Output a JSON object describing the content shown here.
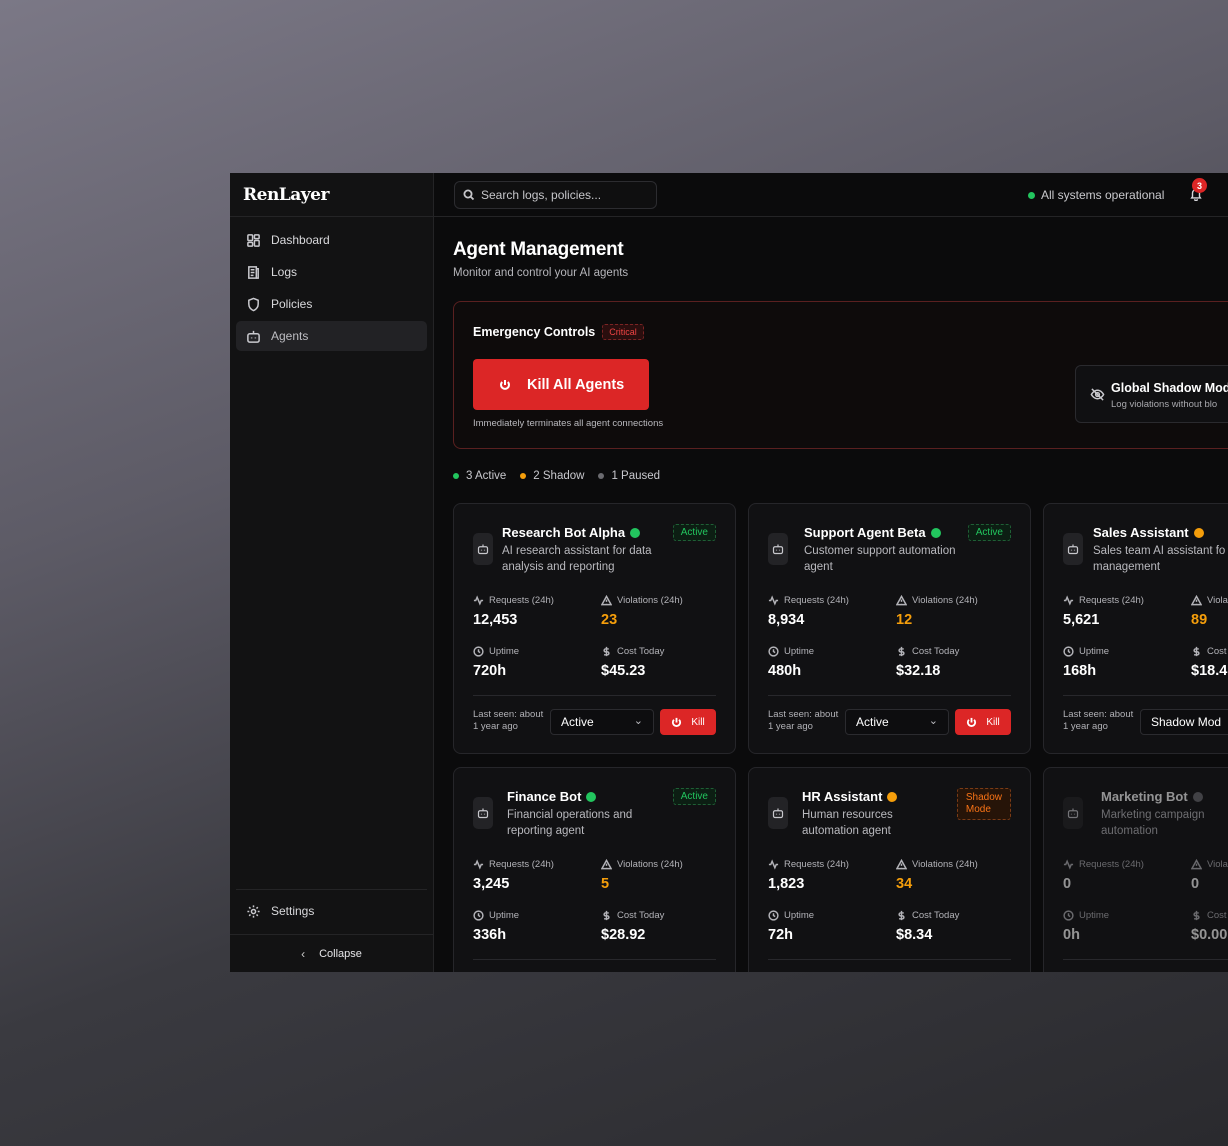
{
  "app": {
    "logo": "RenLayer"
  },
  "sidebar": {
    "items": [
      {
        "label": "Dashboard",
        "icon": "dashboard-icon"
      },
      {
        "label": "Logs",
        "icon": "logs-icon"
      },
      {
        "label": "Policies",
        "icon": "shield-icon"
      },
      {
        "label": "Agents",
        "icon": "bot-icon",
        "active": true
      }
    ],
    "settings_label": "Settings",
    "collapse_label": "Collapse"
  },
  "topbar": {
    "search_placeholder": "Search logs, policies...",
    "status_text": "All systems operational",
    "notification_count": "3"
  },
  "page": {
    "title": "Agent Management",
    "subtitle": "Monitor and control your AI agents"
  },
  "emergency": {
    "title": "Emergency Controls",
    "badge": "Critical",
    "kill_all_label": "Kill All Agents",
    "kill_all_note": "Immediately terminates all agent connections",
    "shadow_title": "Global Shadow Mod",
    "shadow_sub": "Log violations without blo"
  },
  "counts": {
    "active": "3 Active",
    "shadow": "2 Shadow",
    "paused": "1 Paused"
  },
  "labels": {
    "requests": "Requests (24h)",
    "violations": "Violations (24h)",
    "violations_short": "Viola",
    "uptime": "Uptime",
    "cost": "Cost Today",
    "cost_short": "Cost",
    "last_seen_1": "Last seen: about",
    "last_seen_2": "1 year ago",
    "kill": "Kill"
  },
  "agents": [
    {
      "name": "Research Bot Alpha",
      "desc": "AI research assistant for data analysis and reporting",
      "status": "Active",
      "requests": "12,453",
      "violations": "23",
      "uptime": "720h",
      "cost": "$45.23",
      "mode": "Active"
    },
    {
      "name": "Support Agent Beta",
      "desc": "Customer support automation agent",
      "status": "Active",
      "requests": "8,934",
      "violations": "12",
      "uptime": "480h",
      "cost": "$32.18",
      "mode": "Active"
    },
    {
      "name": "Sales Assistant",
      "desc": "Sales team AI assistant fo lead management",
      "status": "",
      "requests": "5,621",
      "violations": "89",
      "uptime": "168h",
      "cost": "$18.4",
      "mode": "Shadow Mod"
    },
    {
      "name": "Finance Bot",
      "desc": "Financial operations and reporting agent",
      "status": "Active",
      "requests": "3,245",
      "violations": "5",
      "uptime": "336h",
      "cost": "$28.92"
    },
    {
      "name": "HR Assistant",
      "desc": "Human resources automation agent",
      "status_line1": "Shadow",
      "status_line2": "Mode",
      "requests": "1,823",
      "violations": "34",
      "uptime": "72h",
      "cost": "$8.34"
    },
    {
      "name": "Marketing Bot",
      "desc": "Marketing campaign automation",
      "status": "",
      "requests": "0",
      "violations": "0",
      "uptime": "0h",
      "cost": "$0.00"
    }
  ],
  "colors": {
    "active": "#22c55e",
    "shadow": "#f59e0b",
    "paused": "#6b6b70",
    "danger": "#dc2626"
  }
}
